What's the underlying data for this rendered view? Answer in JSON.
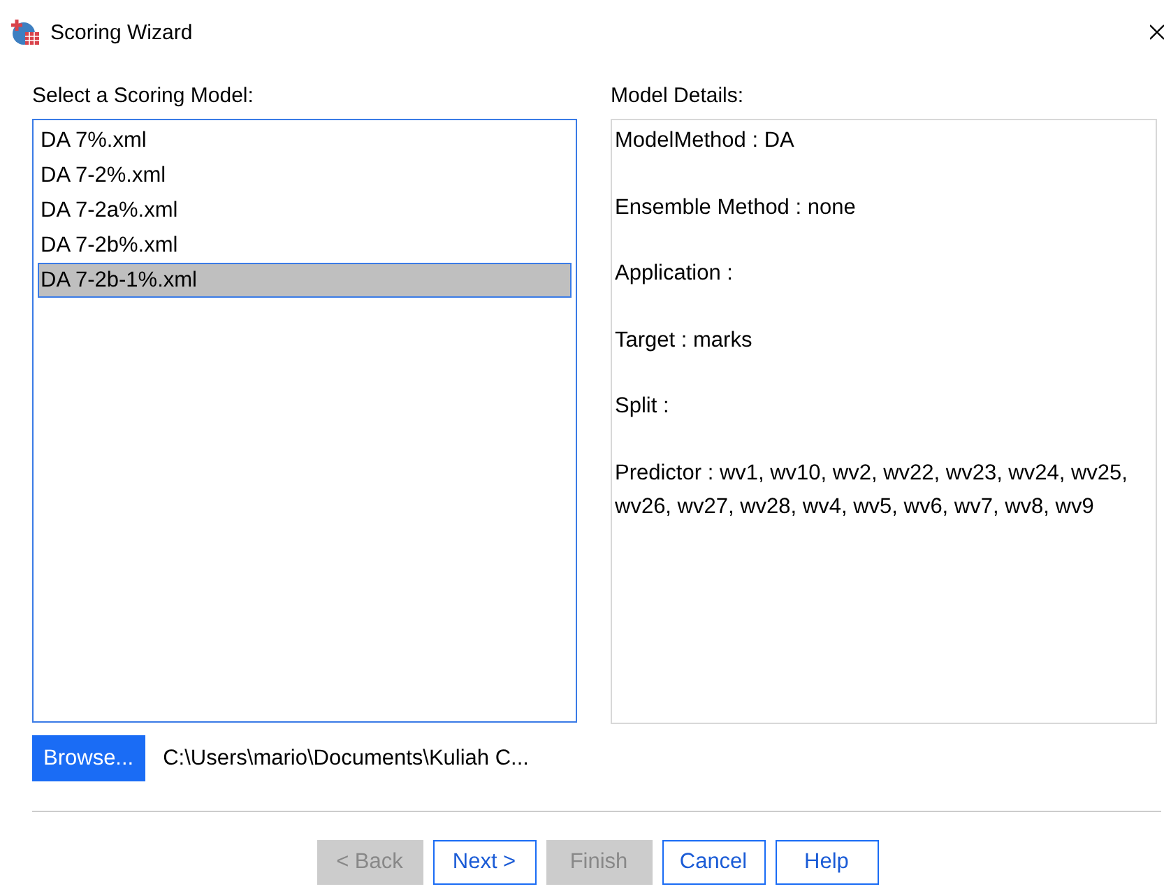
{
  "window": {
    "title": "Scoring Wizard"
  },
  "model_list": {
    "label": "Select a Scoring Model:",
    "items": [
      {
        "name": "DA 7%.xml",
        "selected": false
      },
      {
        "name": "DA 7-2%.xml",
        "selected": false
      },
      {
        "name": "DA 7-2a%.xml",
        "selected": false
      },
      {
        "name": "DA 7-2b%.xml",
        "selected": false
      },
      {
        "name": "DA 7-2b-1%.xml",
        "selected": true
      }
    ]
  },
  "model_details": {
    "label": "Model Details:",
    "lines": [
      "ModelMethod : DA",
      "Ensemble Method : none",
      "Application :",
      "Target : marks",
      "Split :",
      "Predictor : wv1, wv10, wv2, wv22, wv23, wv24, wv25, wv26, wv27, wv28, wv4, wv5, wv6, wv7, wv8, wv9"
    ]
  },
  "browse": {
    "label": "Browse...",
    "path": "C:\\Users\\mario\\Documents\\Kuliah C..."
  },
  "buttons": [
    {
      "label": "<  Back",
      "disabled": true
    },
    {
      "label": "Next  >",
      "disabled": false
    },
    {
      "label": "Finish",
      "disabled": true
    },
    {
      "label": "Cancel",
      "disabled": false
    },
    {
      "label": "Help",
      "disabled": false
    }
  ]
}
